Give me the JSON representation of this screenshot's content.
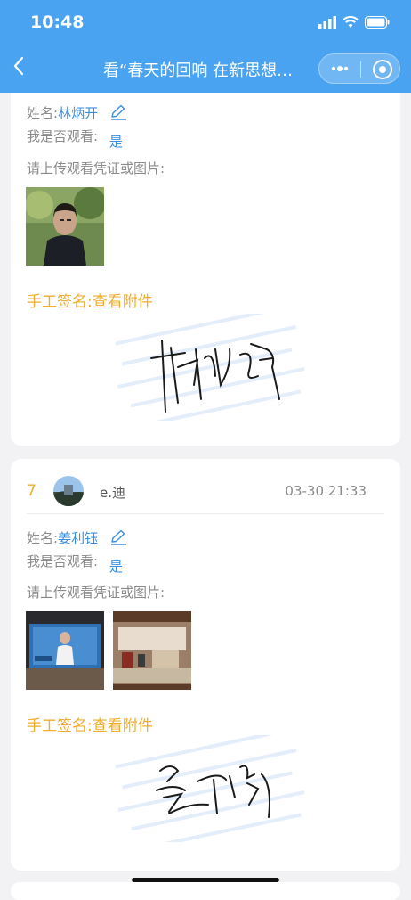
{
  "status": {
    "time": "10:48"
  },
  "nav": {
    "title": "看“春天的回响 在新思想…"
  },
  "cards": [
    {
      "name_label": "姓名:",
      "name_value": "林炳开",
      "watched_label": "我是否观看:",
      "watched_value": "是",
      "upload_label": "请上传观看凭证或图片:",
      "signature_label": "手工签名:",
      "signature_link": "查看附件"
    },
    {
      "index": "7",
      "username": "e.迪",
      "datetime": "03-30 21:33",
      "name_label": "姓名:",
      "name_value": "姜利钰",
      "watched_label": "我是否观看:",
      "watched_value": "是",
      "upload_label": "请上传观看凭证或图片:",
      "signature_label": "手工签名:",
      "signature_link": "查看附件"
    }
  ],
  "colors": {
    "accent": "#4aa3f0",
    "link": "#3d8fe0",
    "signature_label": "#f0ad2e"
  }
}
